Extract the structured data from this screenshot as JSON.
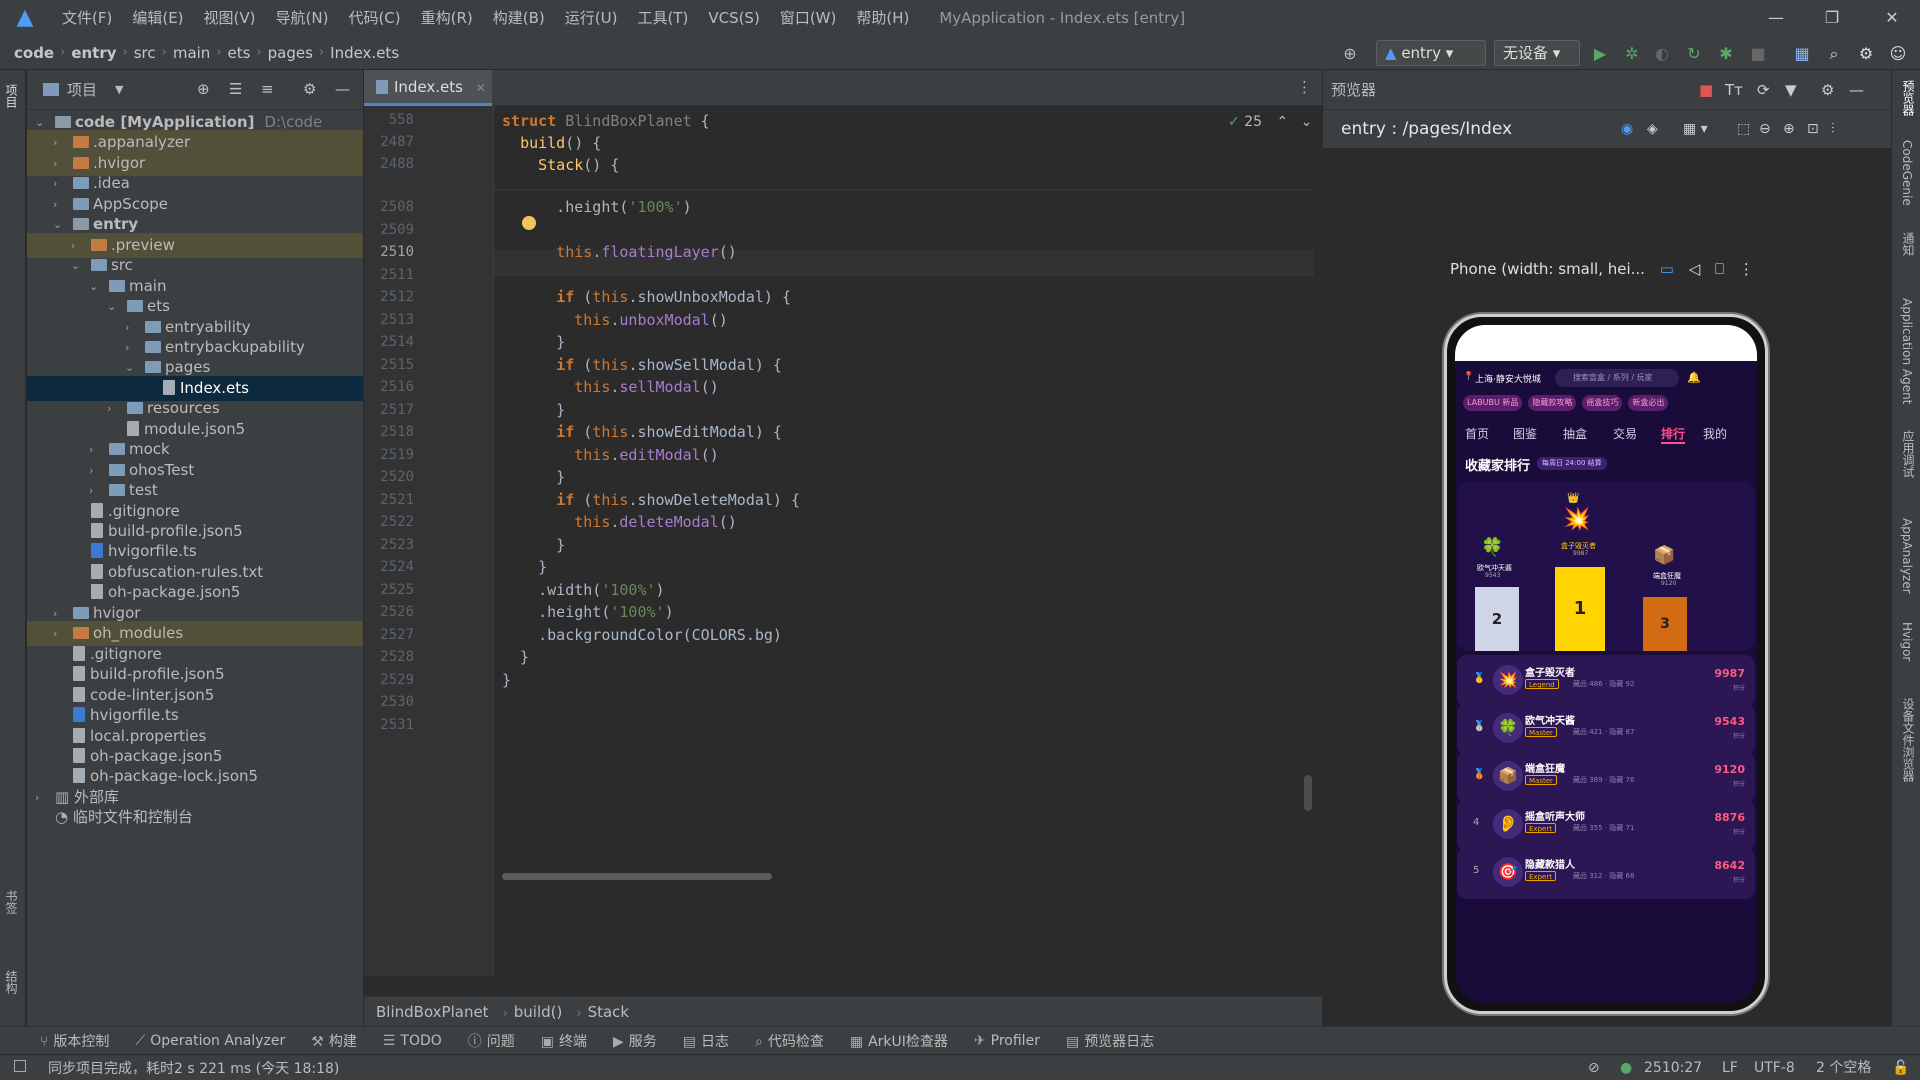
{
  "titlebar": {
    "menus": [
      "文件(F)",
      "编辑(E)",
      "视图(V)",
      "导航(N)",
      "代码(C)",
      "重构(R)",
      "构建(B)",
      "运行(U)",
      "工具(T)",
      "VCS(S)",
      "窗口(W)",
      "帮助(H)"
    ],
    "title": "MyApplication - Index.ets [entry]",
    "minimize": "—",
    "restore": "❐",
    "close": "✕"
  },
  "navbar": {
    "crumbs": [
      "code",
      "entry",
      "src",
      "main",
      "ets",
      "pages",
      "Index.ets"
    ],
    "run_config": "entry",
    "device": "无设备"
  },
  "project": {
    "header": "项目",
    "tree": [
      {
        "label": "code [MyApplication]",
        "note": "D:\\code",
        "depth": 0,
        "open": true,
        "type": "folder-gray",
        "bold": true
      },
      {
        "label": ".appanalyzer",
        "depth": 1,
        "open": false,
        "type": "folder-orange",
        "hl": true
      },
      {
        "label": ".hvigor",
        "depth": 1,
        "open": false,
        "type": "folder-orange",
        "hl": true
      },
      {
        "label": ".idea",
        "depth": 1,
        "open": false,
        "type": "folder-blue"
      },
      {
        "label": "AppScope",
        "depth": 1,
        "open": false,
        "type": "folder-blue"
      },
      {
        "label": "entry",
        "depth": 1,
        "open": true,
        "type": "folder-gray",
        "bold": true
      },
      {
        "label": ".preview",
        "depth": 2,
        "open": false,
        "type": "folder-orange",
        "hl": true
      },
      {
        "label": "src",
        "depth": 2,
        "open": true,
        "type": "folder-blue"
      },
      {
        "label": "main",
        "depth": 3,
        "open": true,
        "type": "folder-blue"
      },
      {
        "label": "ets",
        "depth": 4,
        "open": true,
        "type": "folder-blue"
      },
      {
        "label": "entryability",
        "depth": 5,
        "open": false,
        "type": "folder-blue"
      },
      {
        "label": "entrybackupability",
        "depth": 5,
        "open": false,
        "type": "folder-blue"
      },
      {
        "label": "pages",
        "depth": 5,
        "open": true,
        "type": "folder-blue"
      },
      {
        "label": "Index.ets",
        "depth": 6,
        "type": "file",
        "sel": true
      },
      {
        "label": "resources",
        "depth": 4,
        "open": false,
        "type": "folder-blue"
      },
      {
        "label": "module.json5",
        "depth": 4,
        "type": "file"
      },
      {
        "label": "mock",
        "depth": 3,
        "open": false,
        "type": "folder-blue"
      },
      {
        "label": "ohosTest",
        "depth": 3,
        "open": false,
        "type": "folder-blue"
      },
      {
        "label": "test",
        "depth": 3,
        "open": false,
        "type": "folder-blue"
      },
      {
        "label": ".gitignore",
        "depth": 2,
        "type": "file"
      },
      {
        "label": "build-profile.json5",
        "depth": 2,
        "type": "file"
      },
      {
        "label": "hvigorfile.ts",
        "depth": 2,
        "type": "file-ts"
      },
      {
        "label": "obfuscation-rules.txt",
        "depth": 2,
        "type": "file"
      },
      {
        "label": "oh-package.json5",
        "depth": 2,
        "type": "file"
      },
      {
        "label": "hvigor",
        "depth": 1,
        "open": false,
        "type": "folder-blue"
      },
      {
        "label": "oh_modules",
        "depth": 1,
        "open": false,
        "type": "folder-orange",
        "hl": true
      },
      {
        "label": ".gitignore",
        "depth": 1,
        "type": "file"
      },
      {
        "label": "build-profile.json5",
        "depth": 1,
        "type": "file"
      },
      {
        "label": "code-linter.json5",
        "depth": 1,
        "type": "file"
      },
      {
        "label": "hvigorfile.ts",
        "depth": 1,
        "type": "file-ts"
      },
      {
        "label": "local.properties",
        "depth": 1,
        "type": "file"
      },
      {
        "label": "oh-package.json5",
        "depth": 1,
        "type": "file"
      },
      {
        "label": "oh-package-lock.json5",
        "depth": 1,
        "type": "file"
      },
      {
        "label": "外部库",
        "depth": 0,
        "open": false,
        "type": "lib"
      },
      {
        "label": "临时文件和控制台",
        "depth": 0,
        "type": "scratch"
      }
    ]
  },
  "editor": {
    "tab": "Index.ets",
    "inspections": "25",
    "sticky": [
      {
        "num": "558",
        "code": "struct BlindBoxPlanet {"
      },
      {
        "num": "2487",
        "code": "  build() {"
      },
      {
        "num": "2488",
        "code": "    Stack() {"
      }
    ],
    "lines": [
      {
        "num": "2508",
        "html": "      .height(<span class=\"str\">'100%'</span>)"
      },
      {
        "num": "2509",
        "html": ""
      },
      {
        "num": "2510",
        "html": "      <span class=\"this\">this</span>.<span class=\"call\">floatingLayer</span>()"
      },
      {
        "num": "2511",
        "html": ""
      },
      {
        "num": "2512",
        "html": "      <span class=\"kw\">if</span> (<span class=\"this\">this</span>.showUnboxModal) {"
      },
      {
        "num": "2513",
        "html": "        <span class=\"this\">this</span>.<span class=\"call\">unboxModal</span>()"
      },
      {
        "num": "2514",
        "html": "      }"
      },
      {
        "num": "2515",
        "html": "      <span class=\"kw\">if</span> (<span class=\"this\">this</span>.showSellModal) {"
      },
      {
        "num": "2516",
        "html": "        <span class=\"this\">this</span>.<span class=\"call\">sellModal</span>()"
      },
      {
        "num": "2517",
        "html": "      }"
      },
      {
        "num": "2518",
        "html": "      <span class=\"kw\">if</span> (<span class=\"this\">this</span>.showEditModal) {"
      },
      {
        "num": "2519",
        "html": "        <span class=\"this\">this</span>.<span class=\"call\">editModal</span>()"
      },
      {
        "num": "2520",
        "html": "      }"
      },
      {
        "num": "2521",
        "html": "      <span class=\"kw\">if</span> (<span class=\"this\">this</span>.showDeleteModal) {"
      },
      {
        "num": "2522",
        "html": "        <span class=\"this\">this</span>.<span class=\"call\">deleteModal</span>()"
      },
      {
        "num": "2523",
        "html": "      }"
      },
      {
        "num": "2524",
        "html": "    }"
      },
      {
        "num": "2525",
        "html": "    .width(<span class=\"str\">'100%'</span>)"
      },
      {
        "num": "2526",
        "html": "    .height(<span class=\"str\">'100%'</span>)"
      },
      {
        "num": "2527",
        "html": "    .backgroundColor(COLORS.bg)"
      },
      {
        "num": "2528",
        "html": "  }"
      },
      {
        "num": "2529",
        "html": "}"
      },
      {
        "num": "2530",
        "html": ""
      },
      {
        "num": "2531",
        "html": ""
      }
    ],
    "breadcrumb": [
      "BlindBoxPlanet",
      "build()",
      "Stack"
    ]
  },
  "preview": {
    "header": "预览器",
    "route": "entry : /pages/Index",
    "device": "Phone (width: small, hei...",
    "app": {
      "location": "上海·静安大悦城",
      "search": "搜索盲盒 / 系列 / 玩家",
      "chips": [
        "LABUBU 新品",
        "隐藏款攻略",
        "摇盒技巧",
        "新盒必出"
      ],
      "tabs": [
        "首页",
        "图鉴",
        "抽盒",
        "交易",
        "排行",
        "我的"
      ],
      "section_title": "收藏家排行",
      "section_badge": "每周日 24:00 结算",
      "podium": [
        {
          "rank": "2",
          "name": "欧气冲天酱",
          "score": "9543",
          "icon": "🍀"
        },
        {
          "rank": "1",
          "name": "盒子毁灭者",
          "score": "9987",
          "icon": "💥"
        },
        {
          "rank": "3",
          "name": "端盒狂魔",
          "score": "9120",
          "icon": "📦"
        }
      ],
      "rows": [
        {
          "rank": "🥇",
          "name": "盒子毁灭者",
          "tier": "Legend",
          "meta": "藏品 486 · 隐藏 92",
          "score": "9987",
          "unit": "积分",
          "icon": "💥"
        },
        {
          "rank": "🥈",
          "name": "欧气冲天酱",
          "tier": "Master",
          "meta": "藏品 421 · 隐藏 87",
          "score": "9543",
          "unit": "积分",
          "icon": "🍀"
        },
        {
          "rank": "🥉",
          "name": "端盒狂魔",
          "tier": "Master",
          "meta": "藏品 389 · 隐藏 76",
          "score": "9120",
          "unit": "积分",
          "icon": "📦"
        },
        {
          "rank": "4",
          "name": "摇盒听声大师",
          "tier": "Expert",
          "meta": "藏品 355 · 隐藏 71",
          "score": "8876",
          "unit": "积分",
          "icon": "👂"
        },
        {
          "rank": "5",
          "name": "隐藏款猎人",
          "tier": "Expert",
          "meta": "藏品 312 · 隐藏 68",
          "score": "8642",
          "unit": "积分",
          "icon": "🎯"
        }
      ]
    }
  },
  "bottom_tools": [
    "版本控制",
    "Operation Analyzer",
    "构建",
    "TODO",
    "问题",
    "终端",
    "服务",
    "日志",
    "代码检查",
    "ArkUI检查器",
    "Profiler",
    "预览器日志"
  ],
  "status": {
    "message": "同步项目完成，耗时2 s 221 ms (今天 18:18)",
    "position": "2510:27",
    "line_sep": "LF",
    "encoding": "UTF-8",
    "indent": "2 个空格"
  },
  "right_tabs": [
    "预览器",
    "CodeGenie",
    "通知",
    "Application Agent",
    "应用调试",
    "AppAnalyzer",
    "Hvigor",
    "设备文件浏览器"
  ],
  "left_tabs": [
    "项目",
    "书签",
    "结构"
  ]
}
